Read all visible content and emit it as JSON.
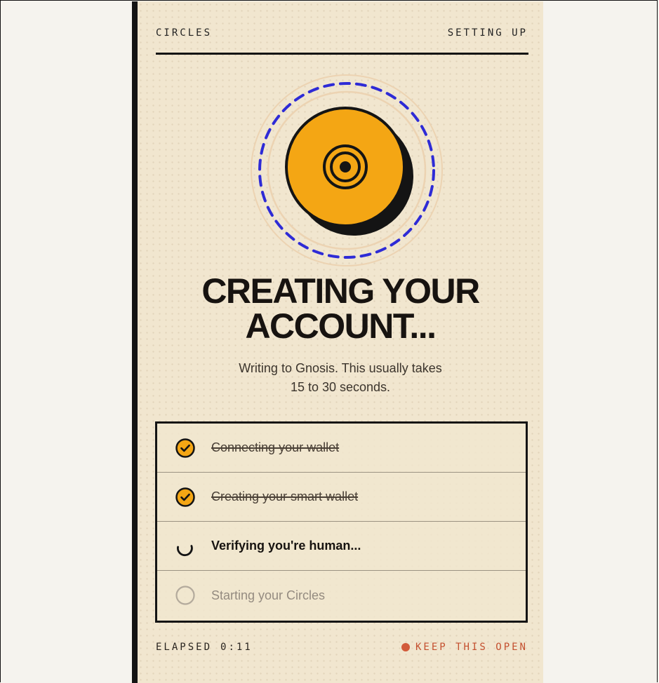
{
  "header": {
    "brand": "CIRCLES",
    "status": "SETTING UP"
  },
  "hero": {
    "icon": "target-coin-icon",
    "coin_color": "#f4a614",
    "ring_color": "#2e2bd6"
  },
  "main": {
    "title_line1": "CREATING YOUR",
    "title_line2": "ACCOUNT...",
    "subtitle_line1": "Writing to Gnosis. This usually takes",
    "subtitle_line2": "15 to 30 seconds."
  },
  "steps": [
    {
      "label": "Connecting your wallet",
      "state": "done",
      "icon": "check-circle-icon"
    },
    {
      "label": "Creating your smart wallet",
      "state": "done",
      "icon": "check-circle-icon"
    },
    {
      "label": "Verifying you're human...",
      "state": "active",
      "icon": "spinner-icon"
    },
    {
      "label": "Starting your Circles",
      "state": "pending",
      "icon": "empty-circle-icon"
    }
  ],
  "footer": {
    "elapsed_label": "ELAPSED",
    "elapsed_time": "0:11",
    "keep_open": "KEEP THIS OPEN",
    "keep_open_color": "#c4502f"
  }
}
